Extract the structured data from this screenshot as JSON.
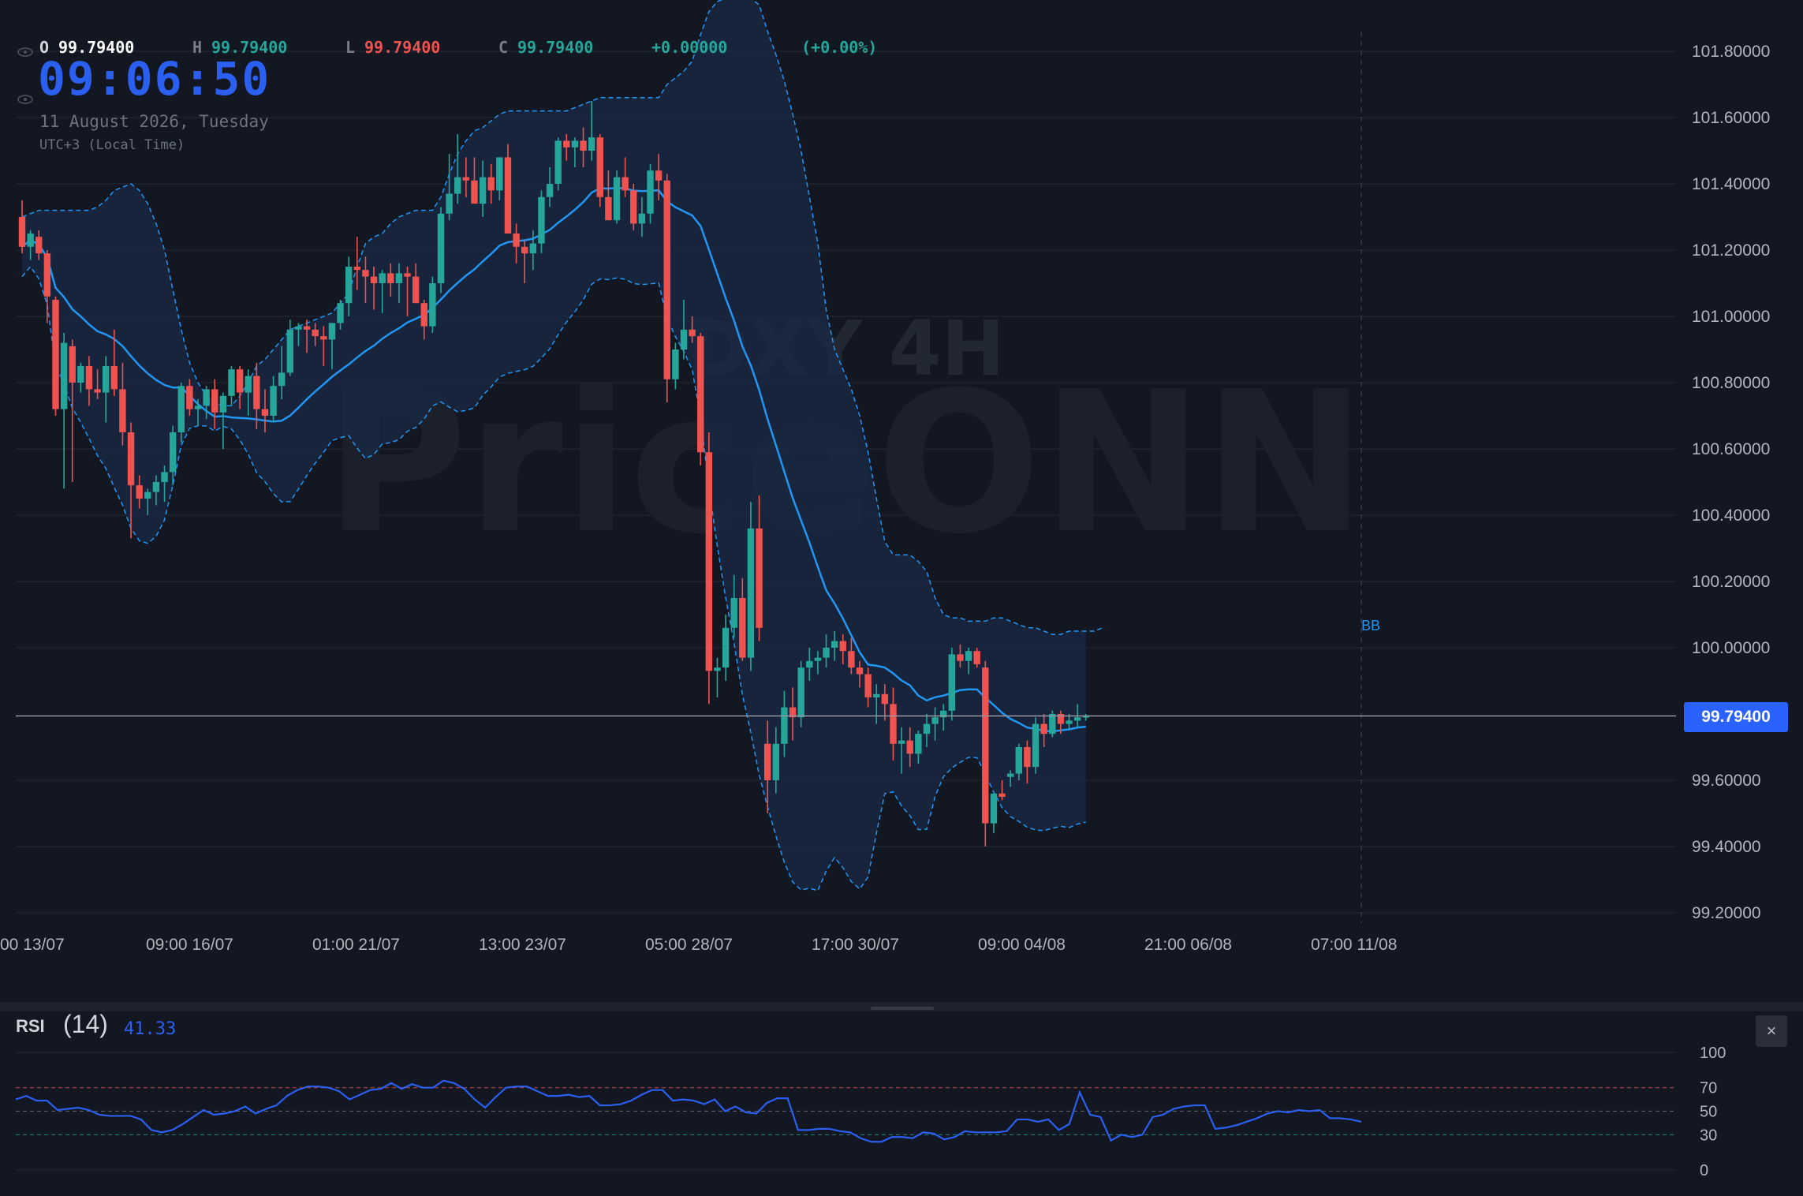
{
  "symbol_watermark": "DXY 4H",
  "brand_watermark": "PriceONN",
  "legend": {
    "o_label": "O",
    "o_value": "99.79400",
    "h_label": "H",
    "h_value": "99.79400",
    "l_label": "L",
    "l_value": "99.79400",
    "c_label": "C",
    "c_value": "99.79400",
    "change": "+0.00000",
    "change_pct": "(+0.00%)"
  },
  "clock": {
    "time": "09:06:50",
    "date": "11 August 2026, Tuesday",
    "timezone": "UTC+3 (Local Time)"
  },
  "price_axis": {
    "labels": [
      "101.80000",
      "101.60000",
      "101.40000",
      "101.20000",
      "101.00000",
      "100.80000",
      "100.60000",
      "100.40000",
      "100.20000",
      "100.00000",
      "99.60000",
      "99.40000",
      "99.20000"
    ],
    "current_price": "99.79400"
  },
  "time_axis": {
    "labels": [
      "00 13/07",
      "09:00 16/07",
      "01:00 21/07",
      "13:00 23/07",
      "05:00 28/07",
      "17:00 30/07",
      "09:00 04/08",
      "21:00 06/08",
      "07:00 11/08"
    ]
  },
  "indicator_tag": "BB",
  "rsi": {
    "title": "RSI",
    "param": "(14)",
    "value": "41.33",
    "axis_labels": [
      "100",
      "70",
      "50",
      "30",
      "0"
    ],
    "close_label": "×"
  },
  "colors": {
    "background": "#131722",
    "up": "#26a69a",
    "down": "#ef5350",
    "bb_line": "#2196f3",
    "bb_fill": "#1a2a45",
    "rsi_line": "#2b5ff0",
    "accent": "#2962ff"
  },
  "chart_data": {
    "type": "candlestick",
    "ylim": [
      99.15,
      101.85
    ],
    "candles": [
      [
        101.3,
        101.35,
        101.19,
        101.21
      ],
      [
        101.21,
        101.26,
        101.17,
        101.25
      ],
      [
        101.24,
        101.26,
        101.17,
        101.19
      ],
      [
        101.19,
        101.2,
        100.98,
        101.06
      ],
      [
        101.05,
        101.06,
        100.7,
        100.72
      ],
      [
        100.72,
        100.95,
        100.48,
        100.92
      ],
      [
        100.91,
        100.93,
        100.5,
        100.8
      ],
      [
        100.8,
        100.86,
        100.77,
        100.85
      ],
      [
        100.85,
        100.88,
        100.73,
        100.78
      ],
      [
        100.78,
        100.84,
        100.75,
        100.77
      ],
      [
        100.77,
        100.88,
        100.68,
        100.85
      ],
      [
        100.85,
        100.96,
        100.76,
        100.78
      ],
      [
        100.78,
        100.86,
        100.61,
        100.65
      ],
      [
        100.65,
        100.68,
        100.33,
        100.49
      ],
      [
        100.49,
        100.52,
        100.42,
        100.45
      ],
      [
        100.45,
        100.48,
        100.4,
        100.47
      ],
      [
        100.47,
        100.52,
        100.43,
        100.5
      ],
      [
        100.5,
        100.55,
        100.44,
        100.53
      ],
      [
        100.53,
        100.67,
        100.49,
        100.65
      ],
      [
        100.65,
        100.8,
        100.62,
        100.79
      ],
      [
        100.79,
        100.81,
        100.7,
        100.72
      ],
      [
        100.72,
        100.75,
        100.67,
        100.73
      ],
      [
        100.73,
        100.79,
        100.69,
        100.78
      ],
      [
        100.78,
        100.81,
        100.66,
        100.71
      ],
      [
        100.71,
        100.77,
        100.6,
        100.76
      ],
      [
        100.76,
        100.85,
        100.73,
        100.84
      ],
      [
        100.84,
        100.85,
        100.72,
        100.77
      ],
      [
        100.77,
        100.84,
        100.7,
        100.82
      ],
      [
        100.82,
        100.86,
        100.66,
        100.72
      ],
      [
        100.72,
        100.78,
        100.65,
        100.7
      ],
      [
        100.7,
        100.82,
        100.68,
        100.79
      ],
      [
        100.79,
        100.91,
        100.75,
        100.83
      ],
      [
        100.83,
        100.99,
        100.82,
        100.96
      ],
      [
        100.96,
        100.98,
        100.91,
        100.97
      ],
      [
        100.97,
        100.99,
        100.89,
        100.96
      ],
      [
        100.96,
        100.98,
        100.91,
        100.94
      ],
      [
        100.94,
        100.97,
        100.85,
        100.93
      ],
      [
        100.93,
        100.98,
        100.84,
        100.98
      ],
      [
        100.98,
        101.05,
        100.96,
        101.04
      ],
      [
        101.04,
        101.18,
        101.0,
        101.15
      ],
      [
        101.15,
        101.24,
        101.08,
        101.14
      ],
      [
        101.14,
        101.18,
        101.04,
        101.12
      ],
      [
        101.12,
        101.15,
        101.02,
        101.1
      ],
      [
        101.1,
        101.14,
        101.01,
        101.13
      ],
      [
        101.13,
        101.16,
        101.06,
        101.1
      ],
      [
        101.1,
        101.16,
        101.04,
        101.13
      ],
      [
        101.13,
        101.15,
        101.0,
        101.12
      ],
      [
        101.12,
        101.16,
        101.05,
        101.04
      ],
      [
        101.04,
        101.05,
        100.93,
        100.97
      ],
      [
        100.97,
        101.12,
        100.95,
        101.1
      ],
      [
        101.1,
        101.33,
        101.07,
        101.31
      ],
      [
        101.31,
        101.49,
        101.29,
        101.37
      ],
      [
        101.37,
        101.55,
        101.34,
        101.42
      ],
      [
        101.42,
        101.48,
        101.36,
        101.41
      ],
      [
        101.41,
        101.48,
        101.34,
        101.34
      ],
      [
        101.34,
        101.47,
        101.3,
        101.42
      ],
      [
        101.42,
        101.46,
        101.34,
        101.38
      ],
      [
        101.38,
        101.48,
        101.35,
        101.48
      ],
      [
        101.48,
        101.52,
        101.25,
        101.25
      ],
      [
        101.25,
        101.28,
        101.16,
        101.21
      ],
      [
        101.21,
        101.23,
        101.1,
        101.19
      ],
      [
        101.19,
        101.26,
        101.14,
        101.22
      ],
      [
        101.22,
        101.38,
        101.19,
        101.36
      ],
      [
        101.36,
        101.45,
        101.33,
        101.4
      ],
      [
        101.4,
        101.54,
        101.38,
        101.53
      ],
      [
        101.53,
        101.55,
        101.47,
        101.51
      ],
      [
        101.51,
        101.54,
        101.45,
        101.53
      ],
      [
        101.53,
        101.57,
        101.45,
        101.5
      ],
      [
        101.5,
        101.65,
        101.47,
        101.54
      ],
      [
        101.54,
        101.55,
        101.33,
        101.36
      ],
      [
        101.36,
        101.44,
        101.3,
        101.29
      ],
      [
        101.29,
        101.44,
        101.28,
        101.42
      ],
      [
        101.42,
        101.48,
        101.36,
        101.38
      ],
      [
        101.38,
        101.4,
        101.26,
        101.28
      ],
      [
        101.28,
        101.36,
        101.24,
        101.31
      ],
      [
        101.31,
        101.46,
        101.28,
        101.44
      ],
      [
        101.44,
        101.49,
        101.35,
        101.41
      ],
      [
        101.41,
        101.43,
        100.74,
        100.81
      ],
      [
        100.81,
        100.92,
        100.78,
        100.9
      ],
      [
        100.9,
        101.05,
        100.87,
        100.96
      ],
      [
        100.96,
        101.0,
        100.92,
        100.94
      ],
      [
        100.94,
        100.95,
        100.55,
        100.59
      ],
      [
        100.59,
        100.65,
        99.83,
        99.93
      ],
      [
        99.93,
        99.97,
        99.85,
        99.94
      ],
      [
        99.94,
        100.1,
        99.9,
        100.06
      ],
      [
        100.06,
        100.22,
        100.03,
        100.15
      ],
      [
        100.15,
        100.21,
        99.96,
        99.97
      ],
      [
        99.97,
        100.44,
        99.93,
        100.36
      ],
      [
        100.36,
        100.46,
        100.02,
        100.06
      ],
      [
        99.71,
        99.78,
        99.5,
        99.6
      ],
      [
        99.6,
        99.76,
        99.56,
        99.71
      ],
      [
        99.71,
        99.87,
        99.67,
        99.82
      ],
      [
        99.82,
        99.88,
        99.72,
        99.79
      ],
      [
        99.79,
        99.96,
        99.76,
        99.94
      ],
      [
        99.94,
        100.0,
        99.9,
        99.96
      ],
      [
        99.96,
        99.99,
        99.92,
        99.97
      ],
      [
        99.97,
        100.04,
        99.94,
        100.0
      ],
      [
        100.0,
        100.05,
        99.96,
        100.02
      ],
      [
        100.02,
        100.04,
        99.95,
        99.99
      ],
      [
        99.99,
        100.03,
        99.92,
        99.94
      ],
      [
        99.94,
        99.96,
        99.88,
        99.92
      ],
      [
        99.92,
        99.94,
        99.82,
        99.85
      ],
      [
        99.85,
        99.89,
        99.77,
        99.86
      ],
      [
        99.86,
        99.89,
        99.78,
        99.83
      ],
      [
        99.83,
        99.88,
        99.66,
        99.71
      ],
      [
        99.71,
        99.76,
        99.62,
        99.72
      ],
      [
        99.72,
        99.76,
        99.64,
        99.68
      ],
      [
        99.68,
        99.75,
        99.65,
        99.74
      ],
      [
        99.74,
        99.8,
        99.7,
        99.77
      ],
      [
        99.77,
        99.82,
        99.72,
        99.79
      ],
      [
        99.79,
        99.83,
        99.75,
        99.81
      ],
      [
        99.81,
        100.0,
        99.78,
        99.98
      ],
      [
        99.98,
        100.01,
        99.94,
        99.96
      ],
      [
        99.96,
        100.0,
        99.92,
        99.99
      ],
      [
        99.99,
        100.0,
        99.94,
        99.95
      ],
      [
        99.94,
        99.96,
        99.4,
        99.47
      ],
      [
        99.47,
        99.56,
        99.44,
        99.56
      ],
      [
        99.56,
        99.6,
        99.54,
        99.55
      ],
      [
        99.61,
        99.63,
        99.58,
        99.62
      ],
      [
        99.62,
        99.71,
        99.6,
        99.7
      ],
      [
        99.7,
        99.72,
        99.59,
        99.64
      ],
      [
        99.64,
        99.79,
        99.62,
        99.77
      ],
      [
        99.77,
        99.8,
        99.7,
        99.74
      ],
      [
        99.74,
        99.81,
        99.73,
        99.8
      ],
      [
        99.8,
        99.81,
        99.74,
        99.77
      ],
      [
        99.77,
        99.8,
        99.75,
        99.78
      ],
      [
        99.78,
        99.83,
        99.76,
        99.79
      ],
      [
        99.79,
        99.8,
        99.78,
        99.794
      ]
    ],
    "rsi": [
      60,
      63,
      59,
      59,
      51,
      52,
      53,
      51,
      47,
      46,
      46,
      46,
      43,
      34,
      32,
      34,
      39,
      45,
      51,
      47,
      48,
      50,
      54,
      48,
      52,
      55,
      63,
      68,
      71,
      71,
      70,
      67,
      60,
      64,
      68,
      69,
      74,
      69,
      73,
      70,
      70,
      76,
      74,
      69,
      60,
      53,
      62,
      70,
      71,
      71,
      67,
      63,
      63,
      64,
      62,
      63,
      55,
      55,
      56,
      59,
      64,
      68,
      68,
      59,
      60,
      59,
      56,
      60,
      50,
      54,
      49,
      48,
      57,
      61,
      61,
      34,
      34,
      35,
      35,
      33,
      32,
      27,
      24,
      24,
      28,
      28,
      27,
      32,
      31,
      26,
      28,
      33,
      32,
      32,
      32,
      33,
      43,
      43,
      41,
      43,
      34,
      39,
      66,
      47,
      45,
      25,
      30,
      28,
      30,
      45,
      47,
      52,
      54,
      55,
      55,
      35,
      36,
      38,
      41,
      44,
      48,
      50,
      49,
      51,
      50,
      51,
      44,
      44,
      43,
      41
    ],
    "bb_upper": [
      101.3,
      101.31,
      101.32,
      101.32,
      101.32,
      101.32,
      101.32,
      101.32,
      101.32,
      101.33,
      101.35,
      101.38,
      101.39,
      101.4,
      101.38,
      101.34,
      101.28,
      101.2,
      101.08,
      100.96,
      100.86,
      100.8,
      100.76,
      100.74,
      100.73,
      100.73,
      100.76,
      100.8,
      100.85,
      100.87,
      100.9,
      100.93,
      100.96,
      100.97,
      100.98,
      100.99,
      101.0,
      101.01,
      101.04,
      101.07,
      101.15,
      101.22,
      101.24,
      101.25,
      101.28,
      101.3,
      101.31,
      101.32,
      101.32,
      101.32,
      101.36,
      101.43,
      101.49,
      101.53,
      101.56,
      101.57,
      101.59,
      101.61,
      101.62,
      101.62,
      101.62,
      101.62,
      101.62,
      101.62,
      101.62,
      101.62,
      101.63,
      101.64,
      101.65,
      101.66,
      101.66,
      101.66,
      101.66,
      101.66,
      101.66,
      101.66,
      101.66,
      101.7,
      101.72,
      101.74,
      101.77,
      101.85,
      101.92,
      101.95,
      101.96,
      101.96,
      101.96,
      101.96,
      101.94,
      101.86,
      101.79,
      101.71,
      101.61,
      101.5,
      101.36,
      101.22,
      101.02,
      100.9,
      100.84,
      100.78,
      100.7,
      100.59,
      100.45,
      100.32,
      100.28,
      100.28,
      100.28,
      100.26,
      100.23,
      100.15,
      100.1,
      100.09,
      100.09,
      100.08,
      100.08,
      100.08,
      100.09,
      100.09,
      100.08,
      100.07,
      100.06,
      100.06,
      100.05,
      100.04,
      100.04,
      100.05,
      100.05,
      100.05,
      100.05,
      100.06
    ]
  }
}
